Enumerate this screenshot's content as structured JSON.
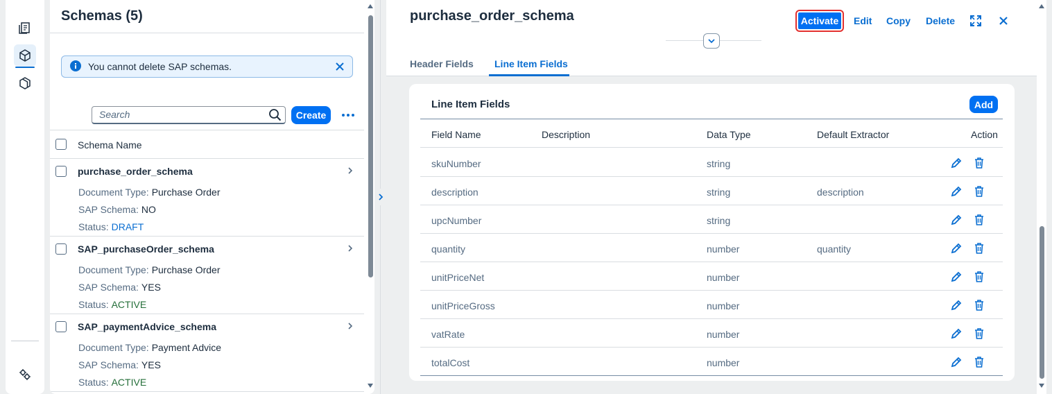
{
  "rail": {
    "items": [
      {
        "name": "documents-icon"
      },
      {
        "name": "schema-icon"
      },
      {
        "name": "template-icon"
      }
    ],
    "bottom": {
      "name": "settings-icon"
    }
  },
  "list": {
    "title": "Schemas (5)",
    "info_message": "You cannot delete SAP schemas.",
    "search_placeholder": "Search",
    "create_label": "Create",
    "column_header": "Schema Name",
    "items": [
      {
        "name": "purchase_order_schema",
        "doc_type_label": "Document Type:",
        "doc_type": "Purchase Order",
        "sap_label": "SAP Schema:",
        "sap": "NO",
        "status_label": "Status:",
        "status": "DRAFT"
      },
      {
        "name": "SAP_purchaseOrder_schema",
        "doc_type_label": "Document Type:",
        "doc_type": "Purchase Order",
        "sap_label": "SAP Schema:",
        "sap": "YES",
        "status_label": "Status:",
        "status": "ACTIVE"
      },
      {
        "name": "SAP_paymentAdvice_schema",
        "doc_type_label": "Document Type:",
        "doc_type": "Payment Advice",
        "sap_label": "SAP Schema:",
        "sap": "YES",
        "status_label": "Status:",
        "status": "ACTIVE"
      }
    ]
  },
  "detail": {
    "title": "purchase_order_schema",
    "actions": {
      "activate": "Activate",
      "edit": "Edit",
      "copy": "Copy",
      "delete": "Delete"
    },
    "tabs": [
      "Header Fields",
      "Line Item Fields"
    ],
    "selected_tab": "Line Item Fields",
    "card_title": "Line Item Fields",
    "add_label": "Add",
    "columns": [
      "Field Name",
      "Description",
      "Data Type",
      "Default Extractor",
      "Action"
    ],
    "rows": [
      {
        "field": "skuNumber",
        "description": "",
        "type": "string",
        "extractor": ""
      },
      {
        "field": "description",
        "description": "",
        "type": "string",
        "extractor": "description"
      },
      {
        "field": "upcNumber",
        "description": "",
        "type": "string",
        "extractor": ""
      },
      {
        "field": "quantity",
        "description": "",
        "type": "number",
        "extractor": "quantity"
      },
      {
        "field": "unitPriceNet",
        "description": "",
        "type": "number",
        "extractor": ""
      },
      {
        "field": "unitPriceGross",
        "description": "",
        "type": "number",
        "extractor": ""
      },
      {
        "field": "vatRate",
        "description": "",
        "type": "number",
        "extractor": ""
      },
      {
        "field": "totalCost",
        "description": "",
        "type": "number",
        "extractor": ""
      }
    ]
  },
  "colors": {
    "accent": "#0070f2",
    "link": "#0a6ed1",
    "active_status": "#256f3a",
    "highlight": "#e2302f"
  }
}
